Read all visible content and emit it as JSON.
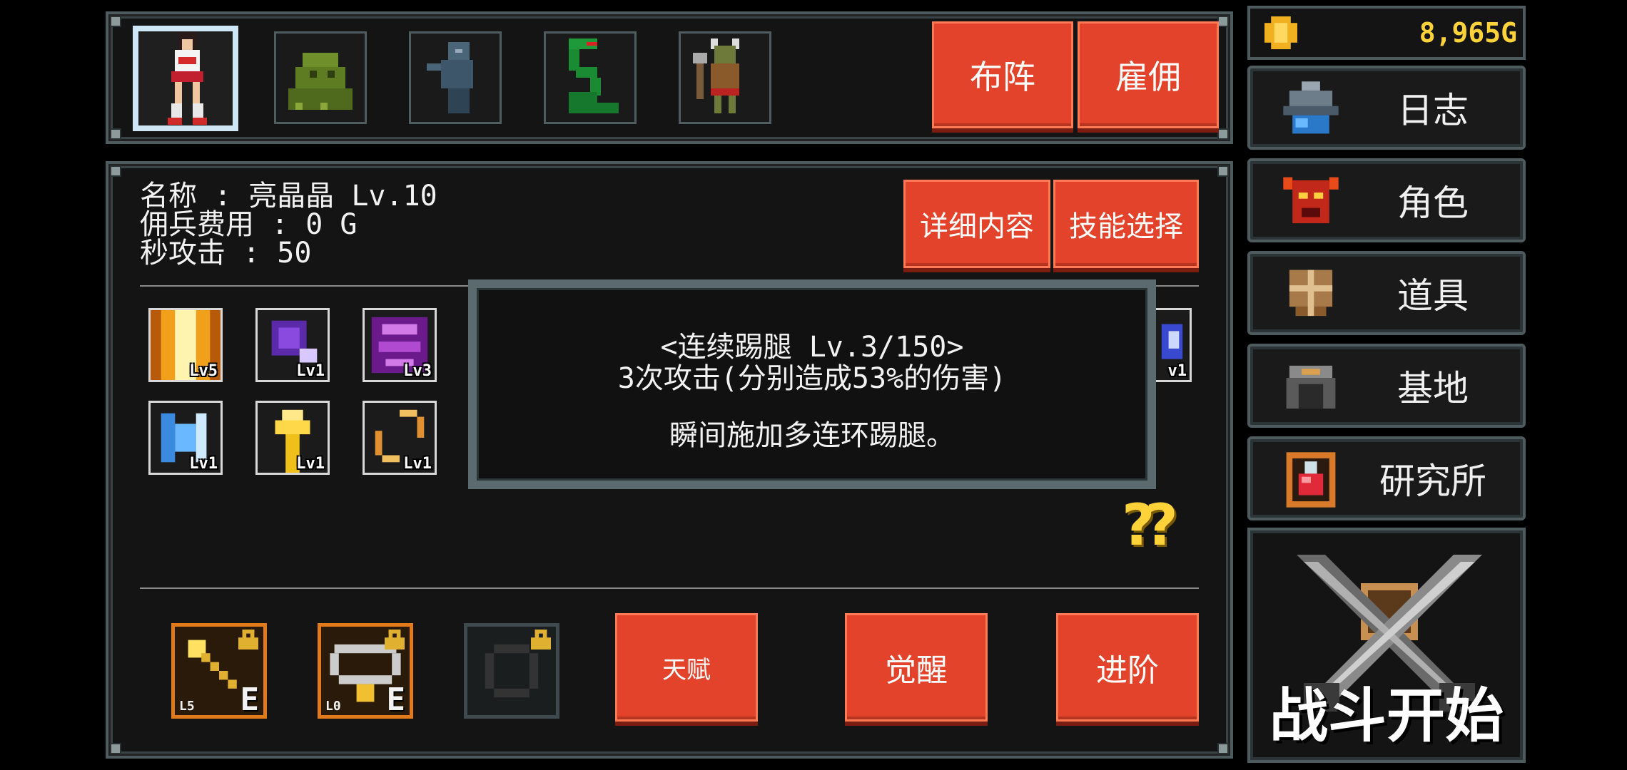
{
  "roster": {
    "characters": [
      {
        "name": "character-girl-fighter",
        "selected": true
      },
      {
        "name": "character-green-slime",
        "selected": false
      },
      {
        "name": "character-hooded-ghost",
        "selected": false
      },
      {
        "name": "character-green-serpent",
        "selected": false
      },
      {
        "name": "character-goblin-axe",
        "selected": false
      }
    ],
    "formation_label": "布阵",
    "hire_label": "雇佣"
  },
  "info": {
    "name_line": "名称 : 亮晶晶 Lv.10",
    "cost_line": "佣兵费用 : 0 G",
    "dps_line": "秒攻击 : 50",
    "details_label": "详细内容",
    "skill_select_label": "技能选择"
  },
  "skills": [
    {
      "icon": "golden-light-skill-icon",
      "level": "Lv5"
    },
    {
      "icon": "purple-orb-skill-icon",
      "level": "Lv1"
    },
    {
      "icon": "purple-vortex-skill-icon",
      "level": "Lv3"
    },
    {
      "icon": "ice-warrior-skill-icon",
      "level": "Lv1"
    },
    {
      "icon": "yellow-arrow-up-skill-icon",
      "level": "Lv1"
    },
    {
      "icon": "kick-chain-skill-icon",
      "level": "Lv1"
    },
    {
      "icon": "partial-skill-icon",
      "level": "v1"
    }
  ],
  "tooltip": {
    "title": "<连续踢腿 Lv.3/150>",
    "effect": "3次攻击(分别造成53%的伤害)",
    "description": "瞬间施加多连环踢腿。"
  },
  "help_label": "??",
  "equipment": [
    {
      "icon": "golden-staff-icon",
      "level": "L5",
      "grade": "E",
      "locked": true
    },
    {
      "icon": "necklace-icon",
      "level": "L0",
      "grade": "E",
      "locked": true
    },
    {
      "icon": "ring-icon",
      "level": "",
      "grade": "",
      "locked": true
    }
  ],
  "actions": {
    "talent_label": "天赋",
    "awaken_label": "觉醒",
    "advance_label": "进阶"
  },
  "sidebar": {
    "gold": "8,965G",
    "items": [
      {
        "label": "日志",
        "icon": "journal-helmet-icon"
      },
      {
        "label": "角色",
        "icon": "demon-mask-icon"
      },
      {
        "label": "道具",
        "icon": "shield-icon"
      },
      {
        "label": "基地",
        "icon": "base-gate-icon"
      },
      {
        "label": "研究所",
        "icon": "potion-flask-icon"
      }
    ],
    "battle_label": "战斗开始"
  },
  "colors": {
    "button_red": "#e2432a",
    "gold_text": "#ffd23a",
    "panel_border": "#4d5a5e",
    "equip_border": "#e07a1a"
  }
}
